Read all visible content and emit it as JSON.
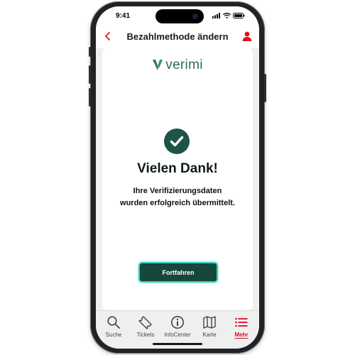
{
  "status_bar": {
    "time": "9:41"
  },
  "header": {
    "title": "Bezahlmethode ändern",
    "back_icon": "chevron-left-icon",
    "profile_icon": "user-icon",
    "accent_color": "#e2101f"
  },
  "verification": {
    "logo_text": "verimi",
    "logo_color": "#2e6e57",
    "success_icon": "checkmark-circle-icon",
    "heading": "Vielen Dank!",
    "message_line1": "Ihre Verifizierungsdaten",
    "message_line2": "wurden erfolgreich übermittelt.",
    "continue_label": "Fortfahren",
    "button_color": "#17463b"
  },
  "tab_bar": {
    "items": [
      {
        "label": "Suche",
        "icon": "search-icon",
        "active": false
      },
      {
        "label": "Tickets",
        "icon": "ticket-icon",
        "active": false
      },
      {
        "label": "InfoCenter",
        "icon": "info-icon",
        "active": false
      },
      {
        "label": "Karte",
        "icon": "map-icon",
        "active": false
      },
      {
        "label": "Mehr",
        "icon": "menu-icon",
        "active": true
      }
    ],
    "active_color": "#d5102a"
  }
}
